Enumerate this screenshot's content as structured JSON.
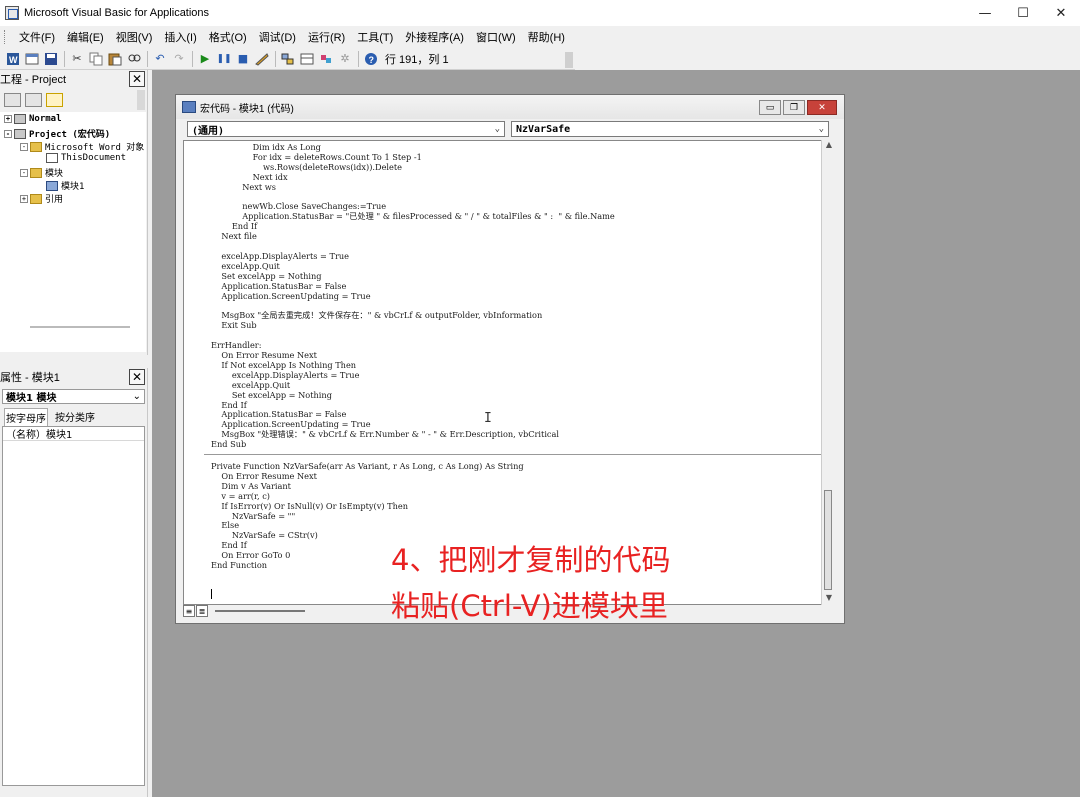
{
  "window": {
    "title": "Microsoft Visual Basic for Applications",
    "controls": [
      "—",
      "☐",
      "✕"
    ]
  },
  "menu": [
    "文件(F)",
    "编辑(E)",
    "视图(V)",
    "插入(I)",
    "格式(O)",
    "调试(D)",
    "运行(R)",
    "工具(T)",
    "外接程序(A)",
    "窗口(W)",
    "帮助(H)"
  ],
  "toolbar": {
    "position_label": "行 191，列 1"
  },
  "project_panel": {
    "title": "工程 - Project",
    "tree": [
      {
        "label": "Normal",
        "icon": "project-icon",
        "expander": "+"
      },
      {
        "label": "Project (宏代码)",
        "icon": "project-icon",
        "expander": "-"
      },
      {
        "label": "Microsoft Word 对象",
        "icon": "folder-icon",
        "expander": "-"
      },
      {
        "label": "ThisDocument",
        "icon": "document-icon",
        "expander": ""
      },
      {
        "label": "模块",
        "icon": "folder-icon",
        "expander": "-"
      },
      {
        "label": "模块1",
        "icon": "module-icon",
        "expander": ""
      },
      {
        "label": "引用",
        "icon": "folder-icon",
        "expander": "+"
      }
    ]
  },
  "properties_panel": {
    "title": "属性 - 模块1",
    "object_select": "模块1 模块",
    "tabs": [
      "按字母序",
      "按分类序"
    ],
    "rows": [
      "（名称）模块1"
    ]
  },
  "code_window": {
    "title": "宏代码 - 模块1 (代码)",
    "object_combo": "(通用)",
    "procedure_combo": "NzVarSafe",
    "code_block_1": "                Dim idx As Long\n                For idx = deleteRows.Count To 1 Step -1\n                    ws.Rows(deleteRows(idx)).Delete\n                Next idx\n            Next ws\n\n            newWb.Close SaveChanges:=True\n            Application.StatusBar = \"已处理 \" & filesProcessed & \" / \" & totalFiles & \" :  \" & file.Name\n        End If\n    Next file\n\n    excelApp.DisplayAlerts = True\n    excelApp.Quit\n    Set excelApp = Nothing\n    Application.StatusBar = False\n    Application.ScreenUpdating = True\n\n    MsgBox \"全局去重完成！文件保存在：\" & vbCrLf & outputFolder, vbInformation\n    Exit Sub\n\nErrHandler:\n    On Error Resume Next\n    If Not excelApp Is Nothing Then\n        excelApp.DisplayAlerts = True\n        excelApp.Quit\n        Set excelApp = Nothing\n    End If\n    Application.StatusBar = False\n    Application.ScreenUpdating = True\n    MsgBox \"处理错误：\" & vbCrLf & Err.Number & \" - \" & Err.Description, vbCritical\nEnd Sub",
    "code_block_2": "Private Function NzVarSafe(arr As Variant, r As Long, c As Long) As String\n    On Error Resume Next\n    Dim v As Variant\n    v = arr(r, c)\n    If IsError(v) Or IsNull(v) Or IsEmpty(v) Then\n        NzVarSafe = \"\"\n    Else\n        NzVarSafe = CStr(v)\n    End If\n    On Error GoTo 0\nEnd Function"
  },
  "overlay": {
    "line1": "4、把刚才复制的代码",
    "line2": "粘贴(Ctrl-V)进模块里"
  }
}
